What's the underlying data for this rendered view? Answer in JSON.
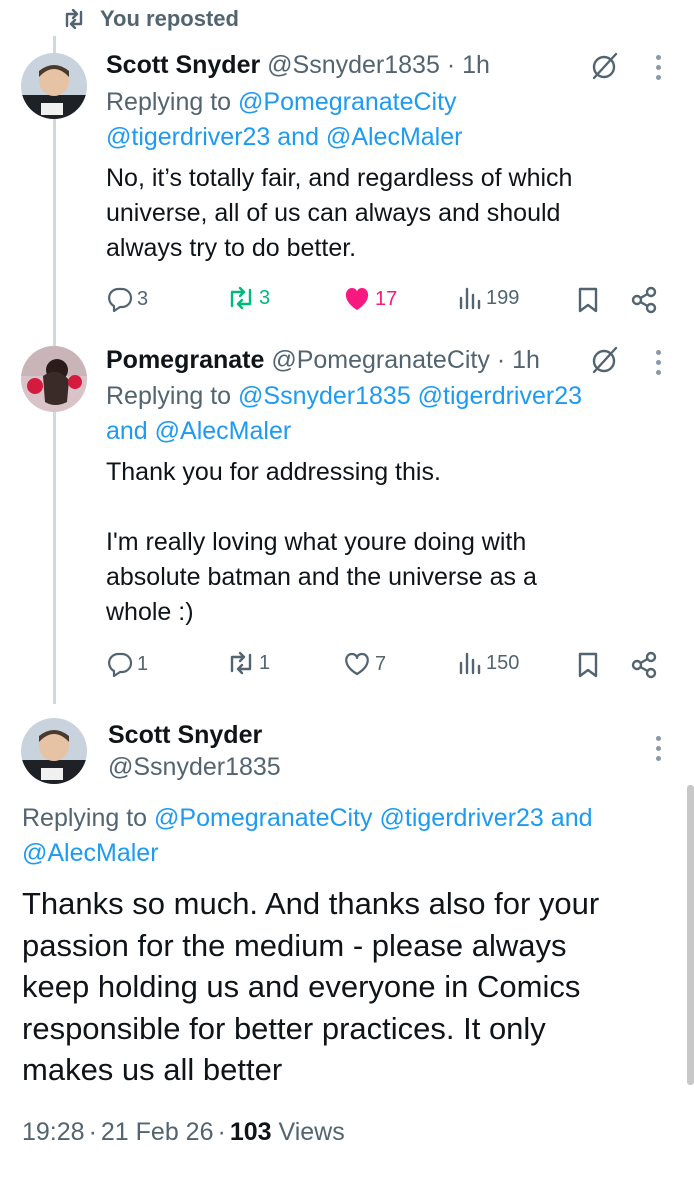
{
  "repost_banner": {
    "label": "You reposted"
  },
  "tweet1": {
    "name": "Scott Snyder",
    "handle": "@Ssnyder1835",
    "sep": "·",
    "time": "1h",
    "replying_prefix": "Replying to",
    "replying_line1": "@PomegranateCity",
    "replying_line2": "@tigerdriver23 and @AlecMaler",
    "body": "No, it’s totally fair, and regardless of which\nuniverse, all of us can always and should\nalways try to do better.",
    "replies": "3",
    "reposts": "3",
    "likes": "17",
    "views": "199"
  },
  "tweet2": {
    "name": "Pomegranate",
    "handle": "@PomegranateCity",
    "sep": "·",
    "time": "1h",
    "replying_prefix": "Replying to",
    "replying_line1": "@Ssnyder1835 @tigerdriver23",
    "replying_line2_and": "and",
    "replying_line2": "@AlecMaler",
    "body": "Thank you for addressing this.\n\nI'm really loving what youre doing with\nabsolute batman and the universe as a\nwhole :)",
    "replies": "1",
    "reposts": "1",
    "likes": "7",
    "views": "150"
  },
  "main_tweet": {
    "name": "Scott Snyder",
    "handle": "@Ssnyder1835",
    "replying_prefix": "Replying to",
    "replying_line1": "@PomegranateCity @tigerdriver23 and",
    "replying_line2": "@AlecMaler",
    "body": "Thanks so much. And thanks also for your\npassion for the medium - please always\nkeep holding us and everyone in Comics\nresponsible for better practices. It only\nmakes us all better",
    "time": "19:28",
    "date": "21 Feb 26",
    "sep": "·",
    "views_count": "103",
    "views_label": "Views"
  },
  "colors": {
    "accent": "#1d9bf0",
    "repost_green": "#00ba7c",
    "like_pink": "#f91880",
    "muted": "#536471"
  },
  "icons": [
    "repost-icon",
    "grok-icon",
    "more-icon",
    "reply-icon",
    "like-icon",
    "views-icon",
    "bookmark-icon",
    "share-icon"
  ]
}
